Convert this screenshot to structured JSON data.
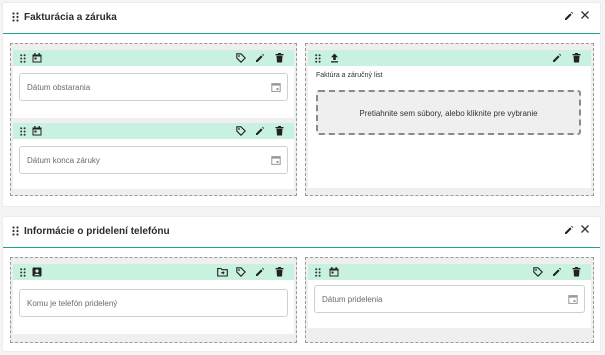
{
  "sections": [
    {
      "title": "Fakturácia a záruka",
      "fields": [
        {
          "placeholder": "Dátum obstarania"
        },
        {
          "placeholder": "Dátum konca záruky"
        }
      ],
      "file_field": {
        "label": "Faktúra a záručný list",
        "dropzone_text": "Pretiahnite sem súbory, alebo kliknite pre vybranie"
      }
    },
    {
      "title": "Informácie o pridelení telefónu",
      "fields": [
        {
          "placeholder": "Komu je telefón pridelený"
        },
        {
          "placeholder": "Dátum pridelenia"
        }
      ]
    }
  ],
  "icons": {
    "drag": "drag-handle-icon",
    "calendar": "calendar-icon",
    "tag": "tag-icon",
    "edit": "pencil-icon",
    "delete": "trash-icon",
    "close": "close-icon",
    "upload": "upload-icon",
    "contact": "contact-card-icon",
    "folder": "folder-move-icon"
  },
  "colors": {
    "accent_line": "#1aa58c",
    "field_bar": "#c9f1e0"
  }
}
